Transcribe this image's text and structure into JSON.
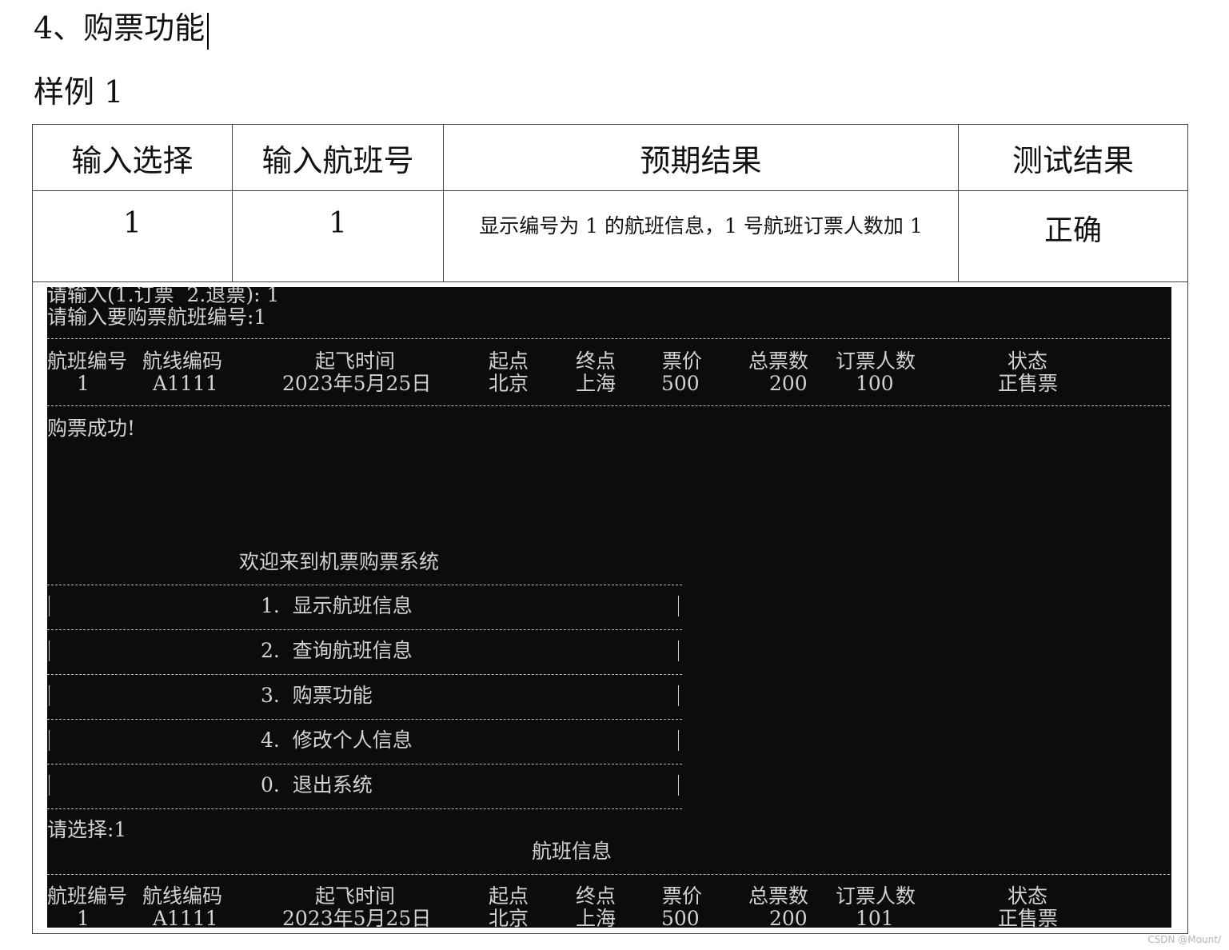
{
  "doc": {
    "section_title": "4、购票功能",
    "example_title": "样例 1"
  },
  "table": {
    "headers": [
      "输入选择",
      "输入航班号",
      "预期结果",
      "测试结果"
    ],
    "row": {
      "choice": "1",
      "flight_no": "1",
      "expected": "显示编号为 1 的航班信息，1 号航班订票人数加 1",
      "result": "正确"
    }
  },
  "terminal": {
    "prompt_mode": "请输入(1.订票  2.退票): 1",
    "prompt_flight": "请输入要购票航班编号:1",
    "columns": [
      "航班编号",
      "航线编码",
      "起飞时间",
      "起点",
      "终点",
      "票价",
      "总票数",
      "订票人数",
      "状态"
    ],
    "flight_before": [
      "1",
      "A1111",
      "2023年5月25日",
      "北京",
      "上海",
      "500",
      "200",
      "100",
      "正售票"
    ],
    "success_msg": "购票成功!",
    "menu_title": "欢迎来到机票购票系统",
    "menu_items": [
      "1.  显示航班信息",
      "2.  查询航班信息",
      "3.  购票功能",
      "4.  修改个人信息",
      "0.  退出系统"
    ],
    "select_prompt": "请选择:1",
    "info_title": "航班信息",
    "flight_after": [
      "1",
      "A1111",
      "2023年5月25日",
      "北京",
      "上海",
      "500",
      "200",
      "101",
      "正售票"
    ]
  },
  "watermark": "CSDN @Mount/"
}
